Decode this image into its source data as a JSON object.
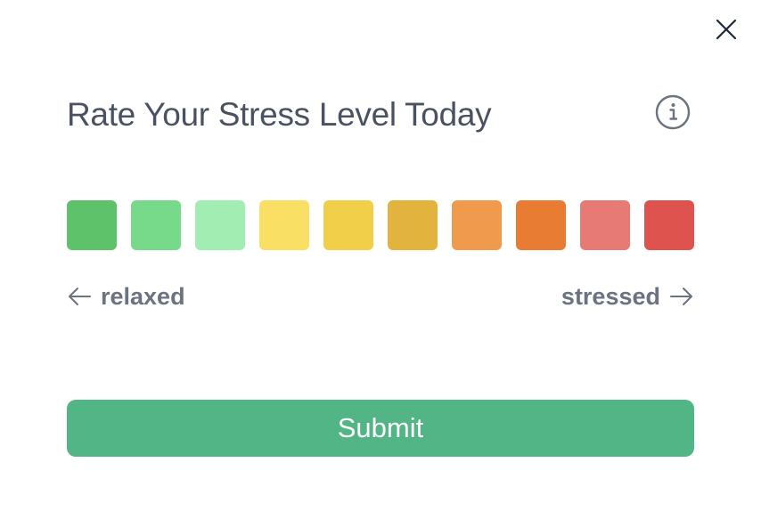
{
  "dialog": {
    "title": "Rate Your Stress Level Today",
    "close_icon": "close-icon",
    "info_icon": "info-icon"
  },
  "scale": {
    "options": [
      {
        "level": 1,
        "color": "#5ec26a"
      },
      {
        "level": 2,
        "color": "#77d98a"
      },
      {
        "level": 3,
        "color": "#a2edb2"
      },
      {
        "level": 4,
        "color": "#f9df63"
      },
      {
        "level": 5,
        "color": "#f2cf48"
      },
      {
        "level": 6,
        "color": "#e2b33d"
      },
      {
        "level": 7,
        "color": "#ef9a4d"
      },
      {
        "level": 8,
        "color": "#e97c33"
      },
      {
        "level": 9,
        "color": "#e77a75"
      },
      {
        "level": 10,
        "color": "#de534e"
      }
    ],
    "low_label": "relaxed",
    "low_icon": "arrow-left-icon",
    "high_label": "stressed",
    "high_icon": "arrow-right-icon"
  },
  "actions": {
    "submit_label": "Submit",
    "submit_color": "#52b585"
  },
  "theme": {
    "title_color": "#4a5262",
    "label_color": "#6b7280"
  }
}
